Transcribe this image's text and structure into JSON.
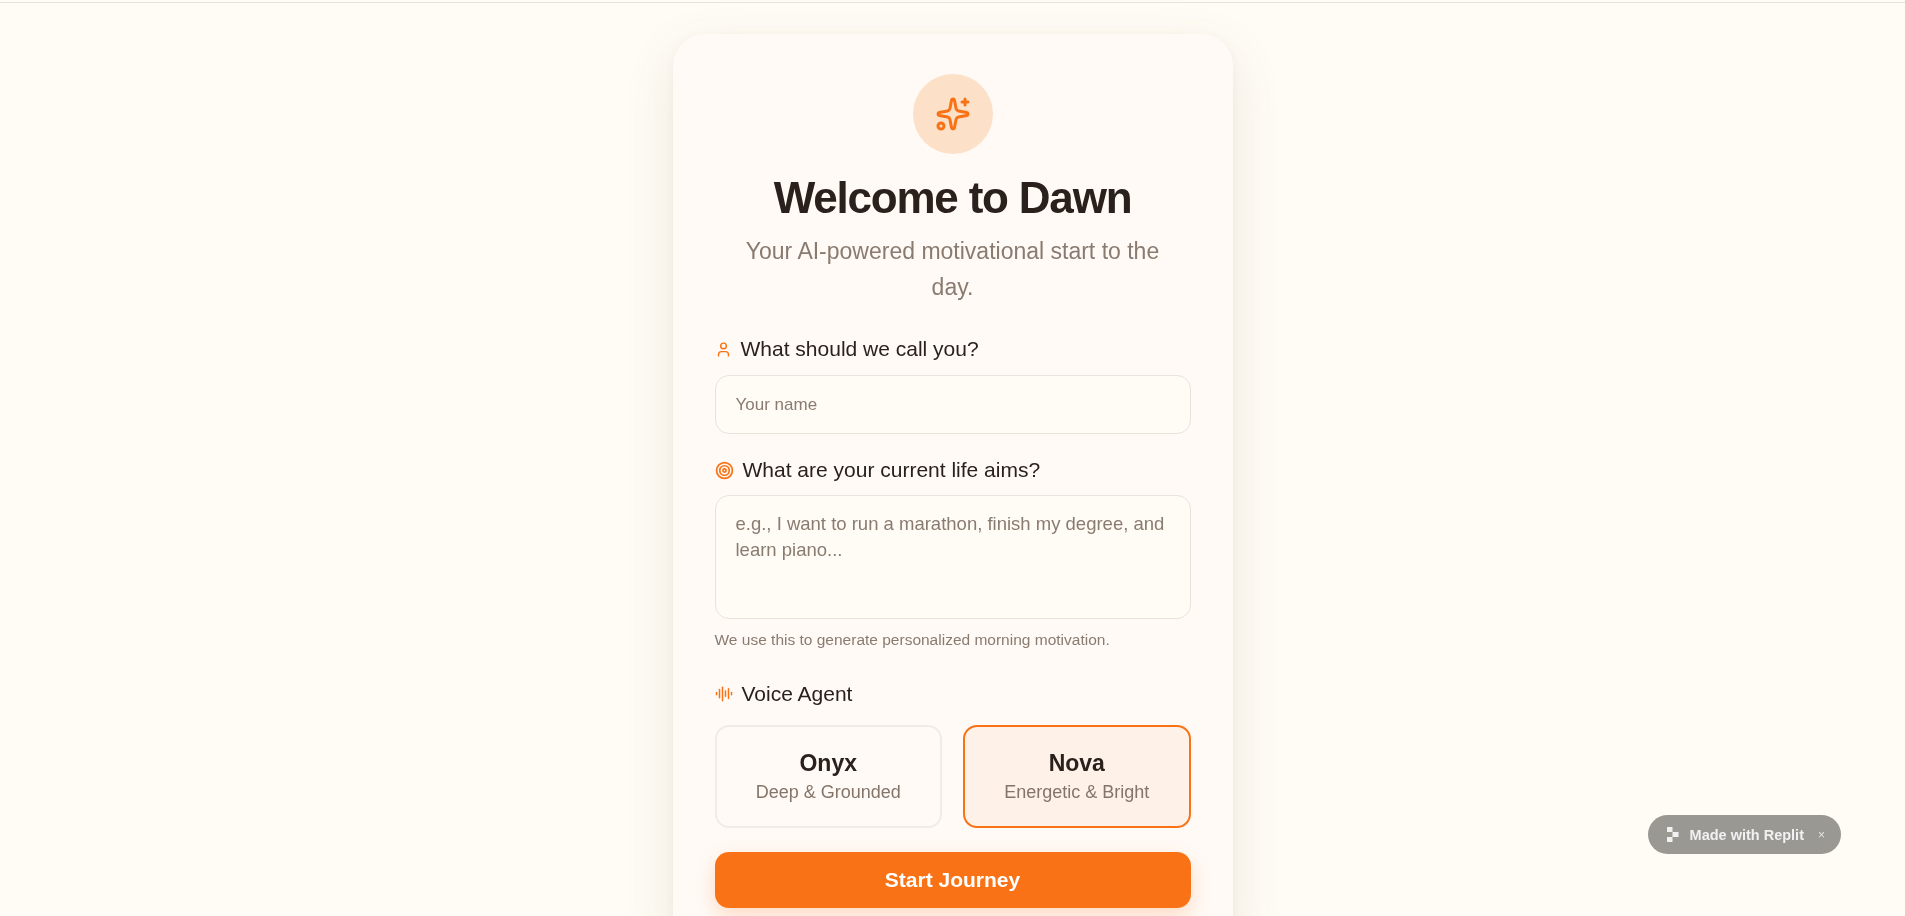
{
  "header": {
    "title": "Welcome to Dawn",
    "subtitle": "Your AI-powered motivational start to the day."
  },
  "form": {
    "fields": [
      {
        "kind": "input",
        "label": "What should we call you?",
        "placeholder": "Your name"
      },
      {
        "kind": "textarea",
        "label": "What are your current life aims?",
        "placeholder": "e.g., I want to run a marathon, finish my degree, and learn piano...",
        "hint": "We use this to generate personalized morning motivation."
      }
    ],
    "voice_agent": {
      "label": "Voice Agent",
      "options": [
        {
          "name": "Onyx",
          "description": "Deep & Grounded",
          "selected": false
        },
        {
          "name": "Nova",
          "description": "Energetic & Bright",
          "selected": true
        }
      ]
    },
    "submit": {
      "label": "Start Journey"
    }
  },
  "badge": {
    "label": "Made with Replit",
    "close": "×"
  }
}
